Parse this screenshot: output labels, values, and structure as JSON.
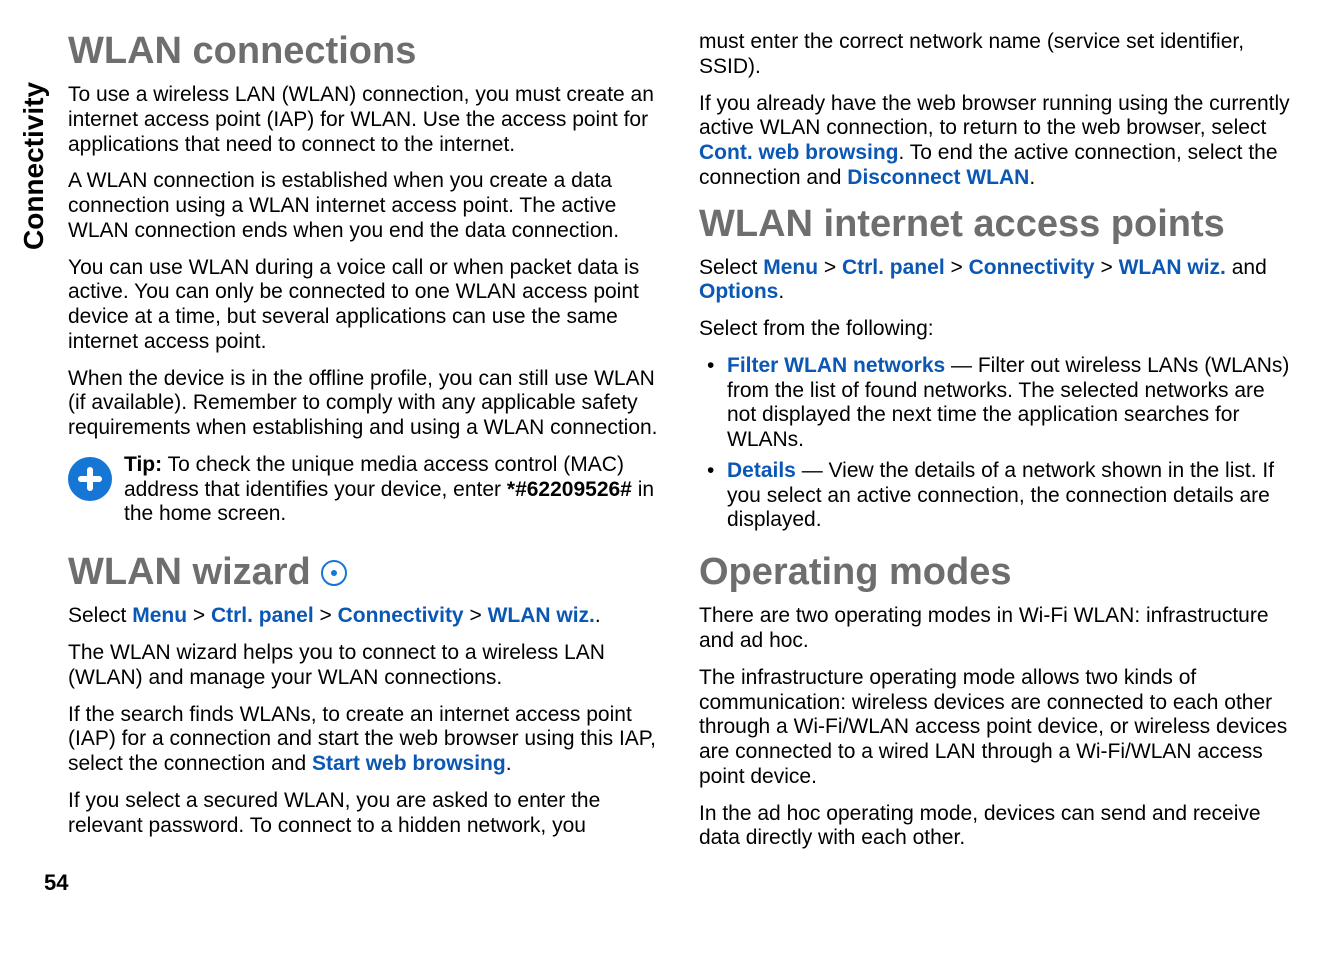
{
  "sidebar_label": "Connectivity",
  "page_number": "54",
  "col1": {
    "h_wlan_conn": "WLAN connections",
    "p1": "To use a wireless LAN (WLAN) connection, you must create an internet access point (IAP) for WLAN. Use the access point for applications that need to connect to the internet.",
    "p2": "A WLAN connection is established when you create a data connection using a WLAN internet access point. The active WLAN connection ends when you end the data connection.",
    "p3": "You can use WLAN during a voice call or when packet data is active. You can only be connected to one WLAN access point device at a time, but several applications can use the same internet access point.",
    "p4": "When the device is in the offline profile, you can still use WLAN (if available). Remember to comply with any applicable safety requirements when establishing and using a WLAN connection.",
    "tip_label": "Tip:",
    "tip_text_a": " To check the unique media access control (MAC) address that identifies your device, enter ",
    "tip_code": "*#62209526#",
    "tip_text_b": " in the home screen.",
    "h_wlan_wiz": "WLAN wizard",
    "sel_a": "Select ",
    "menu": "Menu",
    "gt": " > ",
    "ctrl": "Ctrl. panel",
    "conn": "Connectivity",
    "wiz": "WLAN wiz.",
    "sel_end": ".",
    "p5": "The WLAN wizard helps you to connect to a wireless LAN (WLAN) and manage your WLAN connections.",
    "p6a": "If the search finds WLANs, to create an internet access point (IAP) for a connection and start the web browser using this IAP, select the connection and ",
    "startweb": "Start web browsing",
    "p7": "If you select a secured WLAN, you are asked to enter the relevant password. To connect to a hidden network, you"
  },
  "col2": {
    "p1": "must enter the correct network name (service set identifier, SSID).",
    "p2a": "If you already have the web browser running using the currently active WLAN connection, to return to the web browser, select ",
    "cont": "Cont. web browsing",
    "p2b": ". To end the active connection, select the connection and ",
    "disc": "Disconnect WLAN",
    "h_iap": "WLAN internet access points",
    "sel_a": "Select ",
    "menu": "Menu",
    "gt": " > ",
    "ctrl": "Ctrl. panel",
    "conn": "Connectivity",
    "wiz": "WLAN wiz.",
    "and": " and ",
    "opts": "Options",
    "p3": "Select from the following:",
    "li1_t": "Filter WLAN networks",
    "li1_b": "  — Filter out wireless LANs (WLANs) from the list of found networks. The selected networks are not displayed the next time the application searches for WLANs.",
    "li2_t": "Details",
    "li2_b": "  — View the details of a network shown in the list. If you select an active connection, the connection details are displayed.",
    "h_om": "Operating modes",
    "p4": "There are two operating modes in Wi-Fi WLAN: infrastructure and ad hoc.",
    "p5": "The infrastructure operating mode allows two kinds of communication: wireless devices are connected to each other through a Wi-Fi/WLAN access point device, or wireless devices are connected to a wired LAN through a Wi-Fi/WLAN access point device.",
    "p6": "In the ad hoc operating mode, devices can send and receive data directly with each other."
  }
}
